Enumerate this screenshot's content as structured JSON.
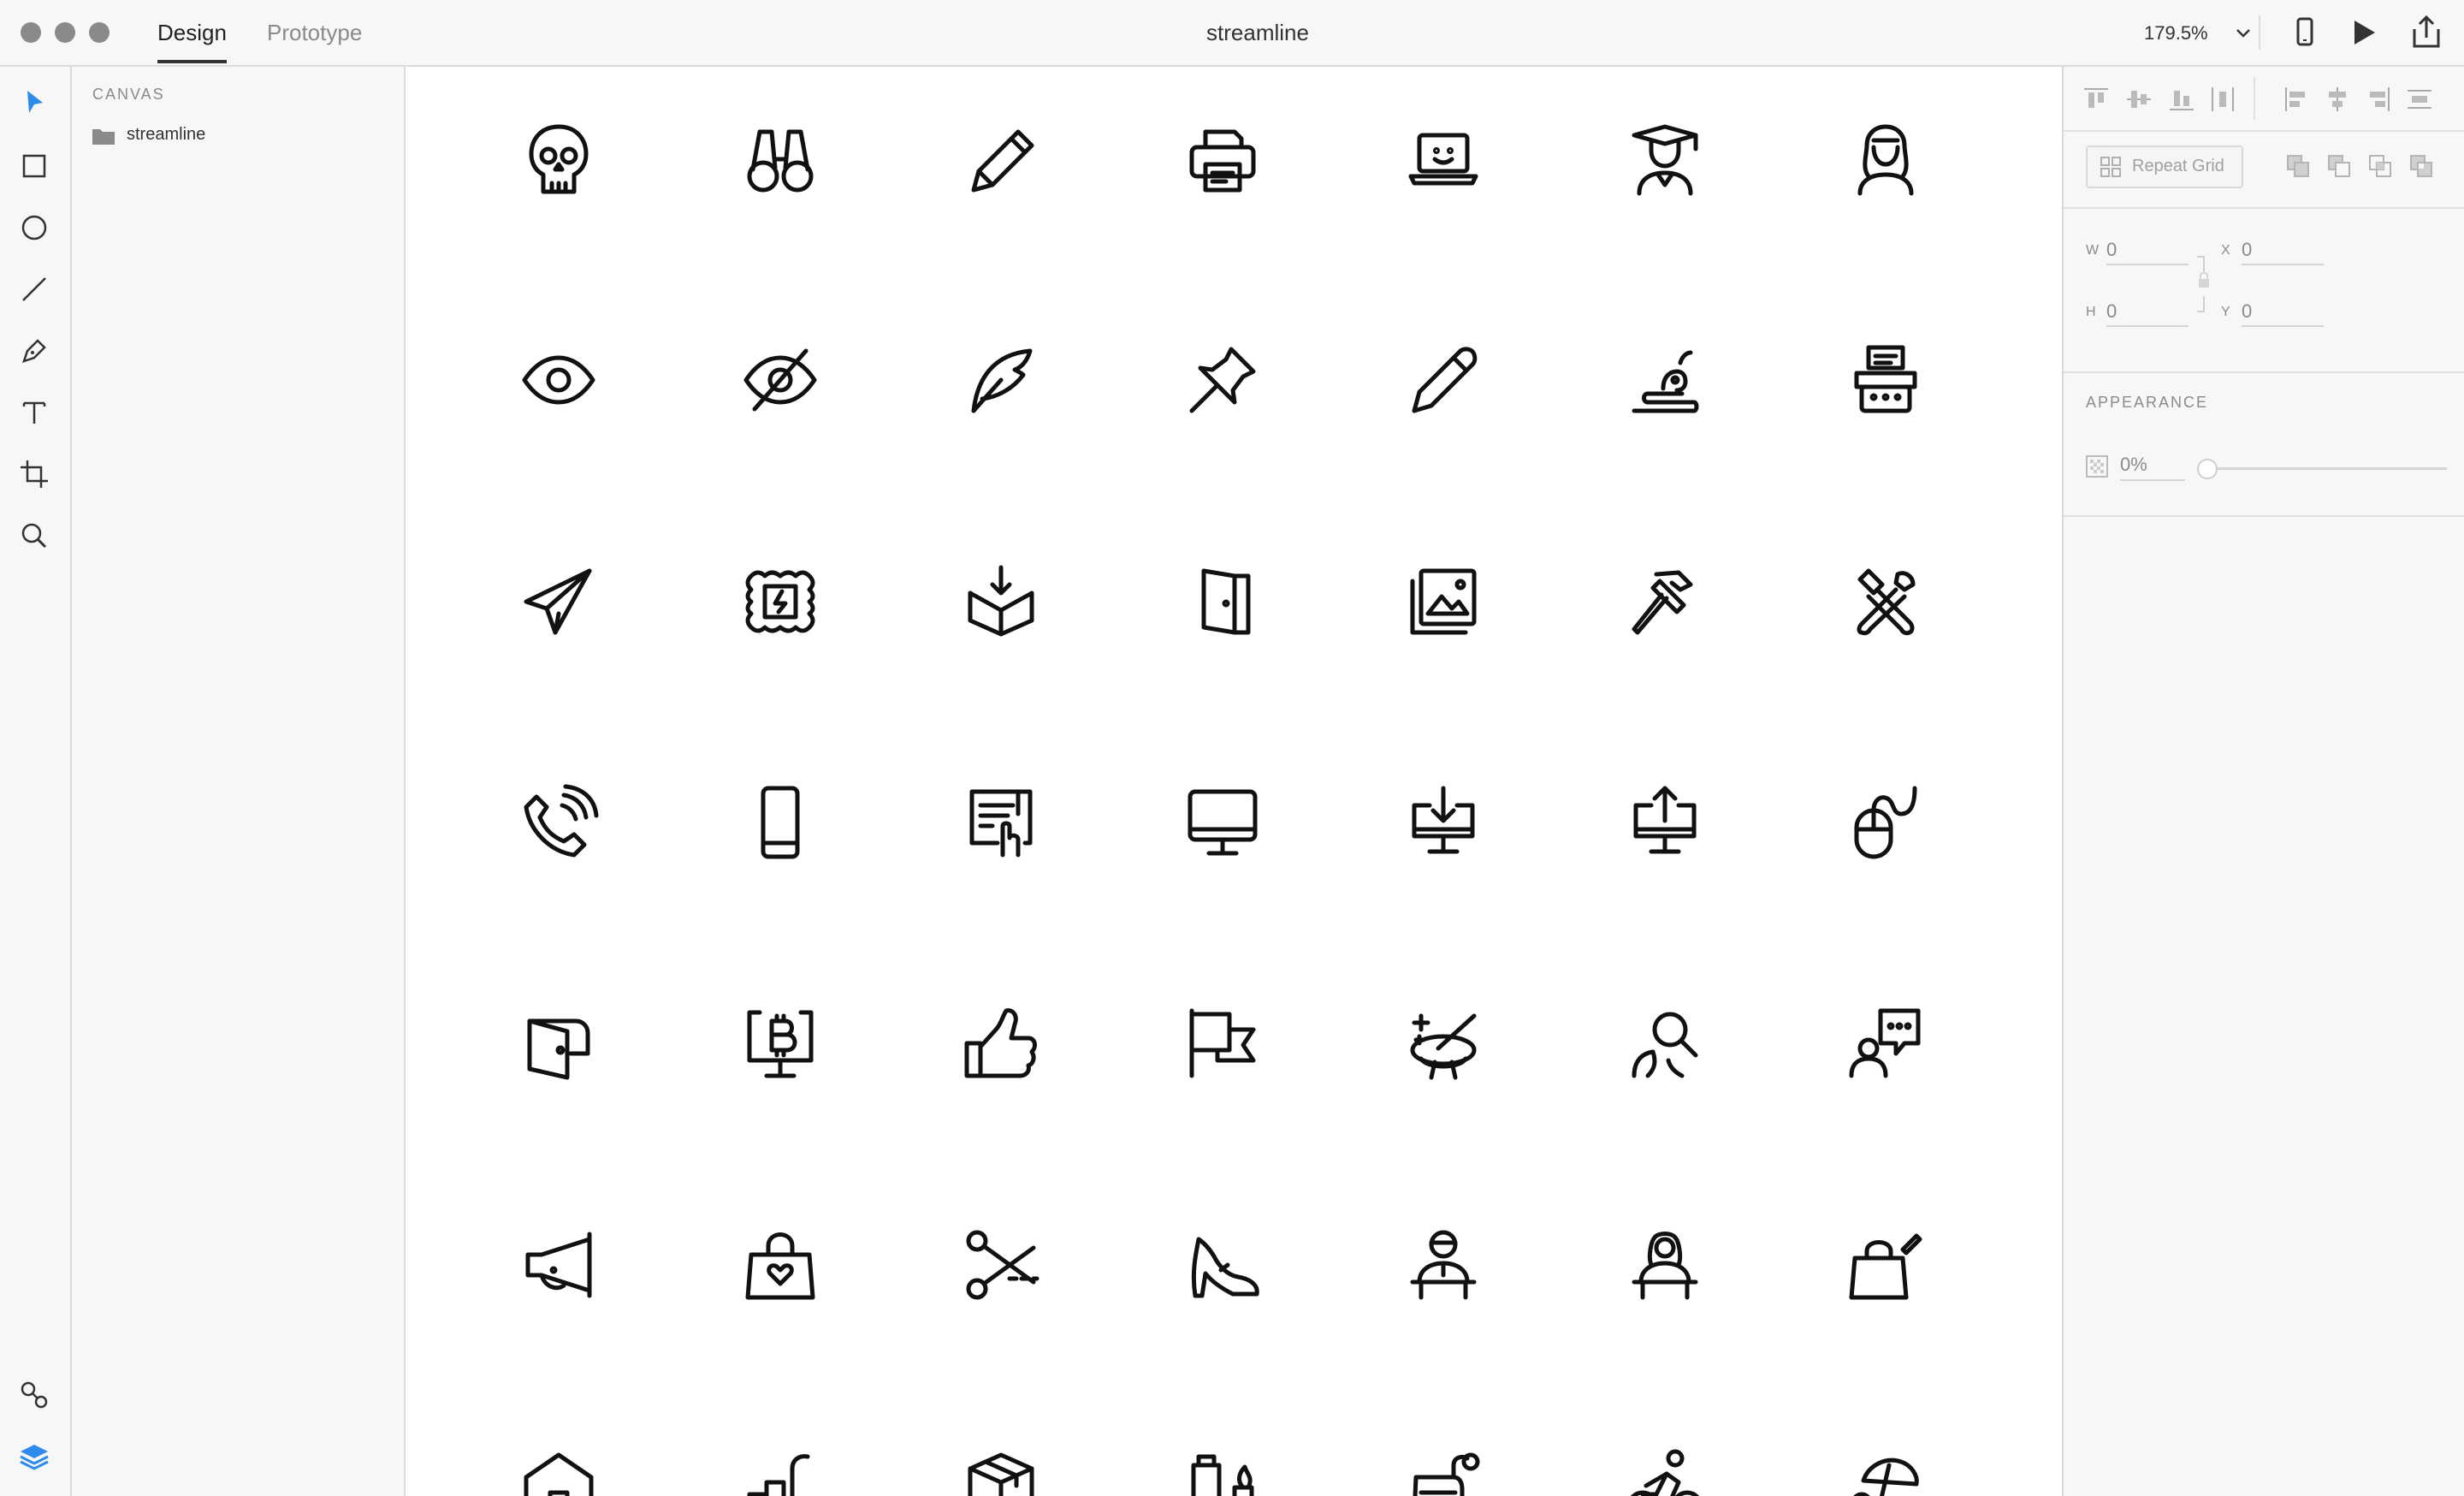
{
  "window": {
    "document_title": "streamline",
    "tabs": [
      {
        "label": "Design",
        "active": true
      },
      {
        "label": "Prototype",
        "active": false
      }
    ],
    "zoom_level": "179.5%"
  },
  "layers_panel": {
    "section_title": "CANVAS",
    "items": [
      {
        "label": "streamline",
        "icon": "folder-icon"
      }
    ]
  },
  "properties_panel": {
    "repeat_grid_label": "Repeat Grid",
    "fields": {
      "w_label": "W",
      "w_value": "0",
      "h_label": "H",
      "h_value": "0",
      "x_label": "X",
      "x_value": "0",
      "y_label": "Y",
      "y_value": "0"
    },
    "appearance_title": "APPEARANCE",
    "opacity_value": "0%"
  },
  "colors": {
    "accent_blue": "#2d8ceb",
    "icon_stroke": "#111111",
    "chrome_gray": "#f7f7f7"
  },
  "canvas_icons": [
    [
      "skull-icon",
      "binoculars-icon",
      "pencil-icon",
      "printer-icon",
      "laptop-smile-icon",
      "graduate-icon",
      "woman-icon"
    ],
    [
      "eye-icon",
      "eye-hidden-icon",
      "quill-icon",
      "pin-icon",
      "pen-icon",
      "paint-brush-icon",
      "typewriter-icon"
    ],
    [
      "paper-plane-icon",
      "stamp-icon",
      "box-download-icon",
      "door-icon",
      "image-gallery-icon",
      "hammer-icon",
      "tools-icon"
    ],
    [
      "phone-ringing-icon",
      "mobile-phone-icon",
      "touch-screen-icon",
      "monitor-icon",
      "monitor-download-icon",
      "monitor-upload-icon",
      "mouse-icon"
    ],
    [
      "wallet-icon",
      "bitcoin-monitor-icon",
      "thumbs-up-icon",
      "flags-icon",
      "magic-hat-icon",
      "user-search-icon",
      "user-chat-icon"
    ],
    [
      "megaphone-icon",
      "shopping-bag-heart-icon",
      "scissors-icon",
      "high-heel-icon",
      "man-desk-icon",
      "woman-desk-icon",
      "shopping-bag-edit-icon"
    ],
    [
      "house-icon",
      "cart-icon",
      "package-icon",
      "paint-can-icon",
      "sewing-machine-icon",
      "cyclist-icon",
      "beach-icon"
    ]
  ]
}
